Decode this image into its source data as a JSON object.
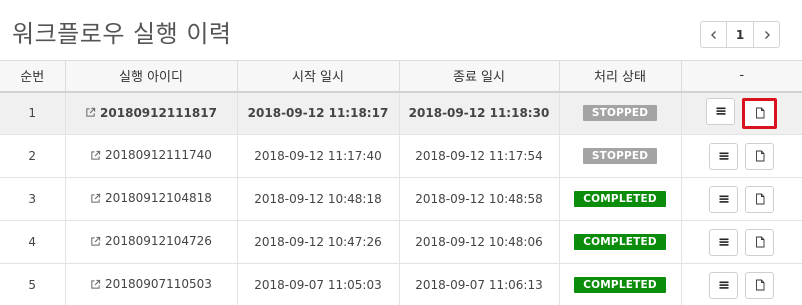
{
  "page": {
    "title": "워크플로우 실행 이력"
  },
  "pager": {
    "prev_icon": "chevron-left-icon",
    "current_page": "1",
    "next_icon": "chevron-right-icon"
  },
  "table": {
    "columns": [
      "순번",
      "실행 아이디",
      "시작 일시",
      "종료 일시",
      "처리 상태",
      "-"
    ],
    "rows": [
      {
        "seq": "1",
        "exec_id": "20180912111817",
        "start": "2018-09-12 11:18:17",
        "end": "2018-09-12 11:18:30",
        "status": "STOPPED",
        "status_color": "#a4a4a4",
        "selected": true
      },
      {
        "seq": "2",
        "exec_id": "20180912111740",
        "start": "2018-09-12 11:17:40",
        "end": "2018-09-12 11:17:54",
        "status": "STOPPED",
        "status_color": "#a4a4a4",
        "selected": false
      },
      {
        "seq": "3",
        "exec_id": "20180912104818",
        "start": "2018-09-12 10:48:18",
        "end": "2018-09-12 10:48:58",
        "status": "COMPLETED",
        "status_color": "#0b8d0b",
        "selected": false
      },
      {
        "seq": "4",
        "exec_id": "20180912104726",
        "start": "2018-09-12 10:47:26",
        "end": "2018-09-12 10:48:06",
        "status": "COMPLETED",
        "status_color": "#0b8d0b",
        "selected": false
      },
      {
        "seq": "5",
        "exec_id": "20180907110503",
        "start": "2018-09-07 11:05:03",
        "end": "2018-09-07 11:06:13",
        "status": "COMPLETED",
        "status_color": "#0b8d0b",
        "selected": false
      }
    ]
  },
  "icons": {
    "external_link": "external-link-icon",
    "list": "list-icon",
    "document": "document-icon"
  },
  "colors": {
    "highlight_border": "#d9121e"
  }
}
